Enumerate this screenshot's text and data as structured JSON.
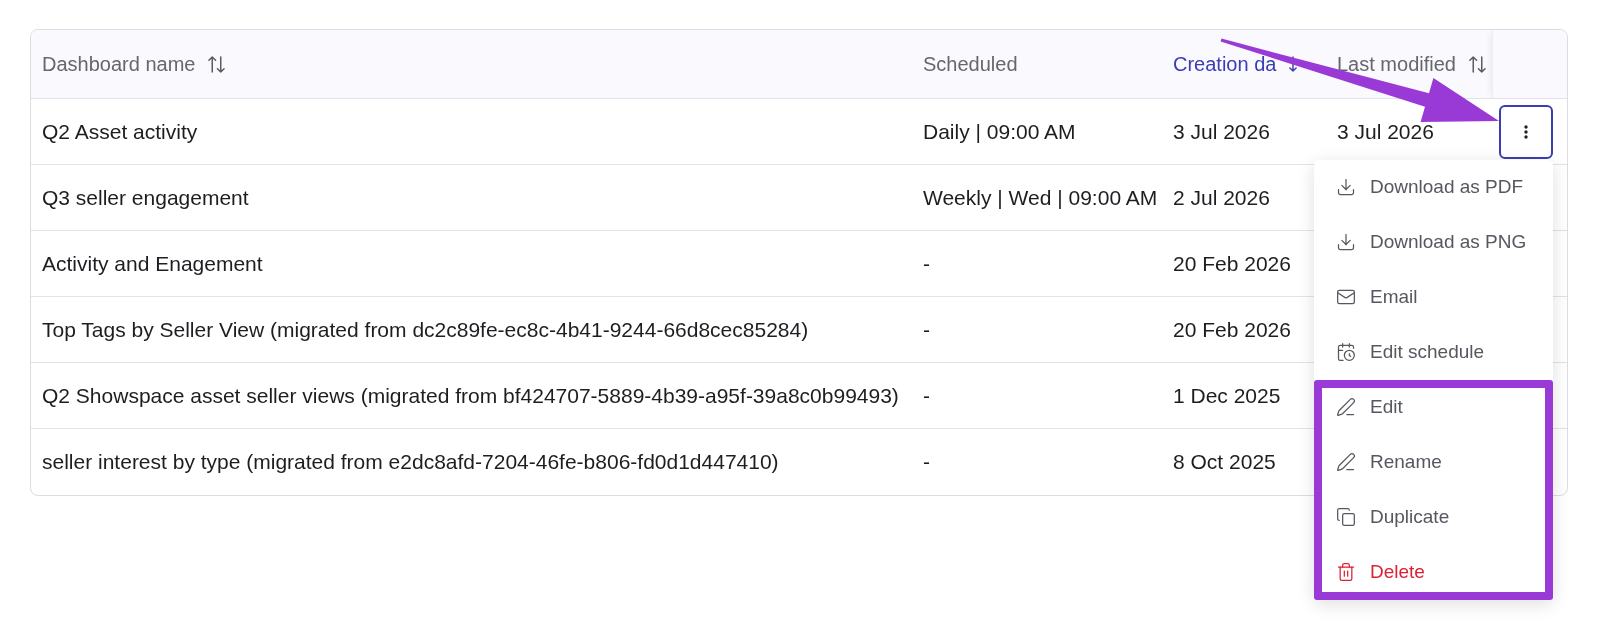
{
  "table": {
    "columns": [
      {
        "label": "Dashboard name",
        "sortable": true,
        "sorted": false
      },
      {
        "label": "Scheduled",
        "sortable": false,
        "sorted": false
      },
      {
        "label": "Creation da",
        "sortable": true,
        "sorted": true
      },
      {
        "label": "Last modified",
        "sortable": true,
        "sorted": false
      }
    ],
    "rows": [
      {
        "name": "Q2 Asset activity",
        "scheduled": "Daily | 09:00 AM",
        "created": "3 Jul 2026",
        "last_modified": "3 Jul 2026"
      },
      {
        "name": "Q3 seller engagement",
        "scheduled": "Weekly | Wed | 09:00 AM",
        "created": "2 Jul 2026"
      },
      {
        "name": "Activity and Enagement",
        "scheduled": "-",
        "created": "20 Feb 2026"
      },
      {
        "name": "Top Tags by Seller View (migrated from dc2c89fe-ec8c-4b41-9244-66d8cec85284)",
        "scheduled": "-",
        "created": "20 Feb 2026"
      },
      {
        "name": "Q2 Showspace asset seller views (migrated from bf424707-5889-4b39-a95f-39a8c0b99493)",
        "scheduled": "-",
        "created": "1 Dec 2025"
      },
      {
        "name": "seller interest by type (migrated from e2dc8afd-7204-46fe-b806-fd0d1d447410)",
        "scheduled": "-",
        "created": "8 Oct 2025"
      }
    ]
  },
  "row_menu": {
    "open": true,
    "items": [
      {
        "label": "Download as PDF",
        "danger": false,
        "highlighted": false
      },
      {
        "label": "Download as PNG",
        "danger": false,
        "highlighted": false
      },
      {
        "label": "Email",
        "danger": false,
        "highlighted": false
      },
      {
        "label": "Edit schedule",
        "danger": false,
        "highlighted": false
      },
      {
        "label": "Edit",
        "danger": false,
        "highlighted": true
      },
      {
        "label": "Rename",
        "danger": false,
        "highlighted": true
      },
      {
        "label": "Duplicate",
        "danger": false,
        "highlighted": true
      },
      {
        "label": "Delete",
        "danger": true,
        "highlighted": true
      }
    ]
  }
}
